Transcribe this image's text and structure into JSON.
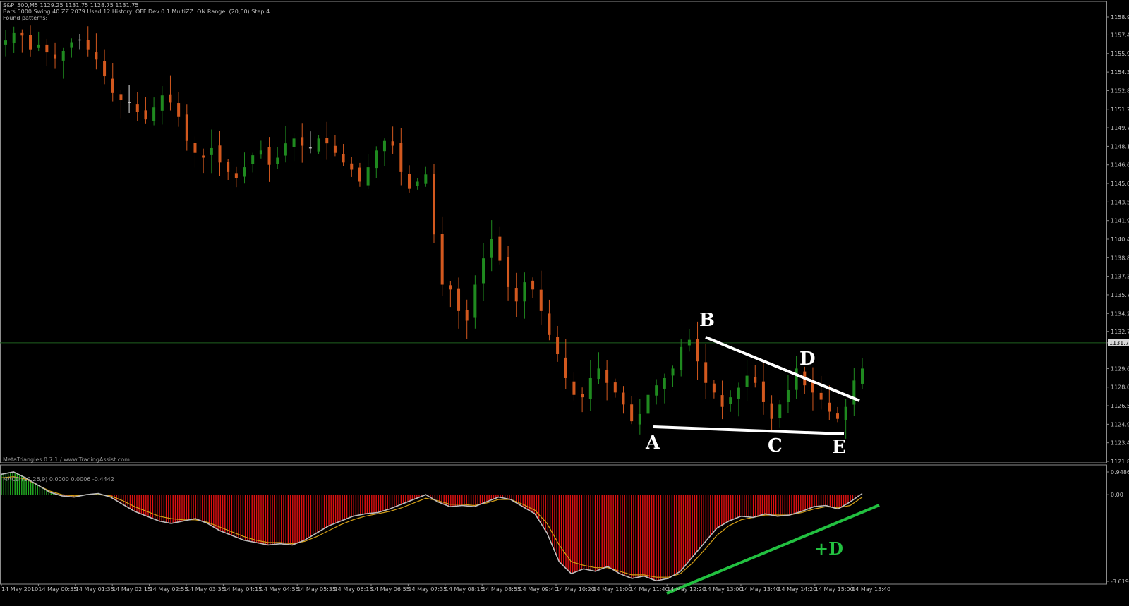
{
  "header": {
    "line1": "S&P_500,M5  1129.25 1131.75 1128.75 1131.75",
    "line2": "Bars:5000  Swing:40  ZZ:2079  Used:12  History: OFF Dev:0.1  MultiZZ: ON  Range: (20,60)  Step:4",
    "line3": "Found patterns:"
  },
  "watermark": "MetaTriangles 0.7.1 / www.TradingAssist.com",
  "macd_label": "MACD (12,26,9) 0.0000 0.0006 -0.4442",
  "price_axis": [
    "1158.95",
    "1157.45",
    "1155.90",
    "1154.35",
    "1152.80",
    "1151.25",
    "1149.70",
    "1148.15",
    "1146.60",
    "1145.05",
    "1143.50",
    "1141.95",
    "1140.40",
    "1138.85",
    "1137.30",
    "1135.75",
    "1134.20",
    "1132.70",
    "1131.75",
    "1129.60",
    "1128.05",
    "1126.50",
    "1124.95",
    "1123.40",
    "1121.85"
  ],
  "current_price": "1131.75",
  "macd_axis": [
    "0.9486",
    "0.00",
    "-3.6195"
  ],
  "time_axis": [
    "14 May 2010",
    "14 May 00:55",
    "14 May 01:35",
    "14 May 02:15",
    "14 May 02:55",
    "14 May 03:35",
    "14 May 04:15",
    "14 May 04:55",
    "14 May 05:35",
    "14 May 06:15",
    "14 May 06:55",
    "14 May 07:35",
    "14 May 08:15",
    "14 May 08:55",
    "14 May 09:40",
    "14 May 10:20",
    "14 May 11:00",
    "14 May 11:40",
    "14 May 12:20",
    "14 May 13:00",
    "14 May 13:40",
    "14 May 14:20",
    "14 May 15:00",
    "14 May 15:40"
  ],
  "pattern_labels": {
    "A": "A",
    "B": "B",
    "C": "C",
    "D": "D",
    "E": "E"
  },
  "divergence_label": "+D",
  "colors": {
    "bull": "#1f8a1f",
    "bear": "#d2581e",
    "neutral": "#e6e6e6",
    "hist_pos": "#22b022",
    "hist_neg": "#e01010",
    "signal": "#d4a017",
    "macd": "#bdbdbd",
    "pattern": "#ffffff",
    "divergence": "#22c040"
  },
  "chart_data": {
    "type": "candlestick",
    "symbol": "S&P_500",
    "timeframe": "M5",
    "ylim": [
      1121.85,
      1158.95
    ],
    "close_path": [
      1157.0,
      1157.6,
      1157.4,
      1156.2,
      1156.6,
      1156.0,
      1155.5,
      1156.1,
      1156.8,
      1157.0,
      1156.2,
      1155.4,
      1154.0,
      1152.6,
      1152.0,
      1151.8,
      1151.0,
      1150.4,
      1151.4,
      1152.4,
      1151.8,
      1150.6,
      1148.6,
      1147.6,
      1147.2,
      1148.0,
      1146.8,
      1146.0,
      1145.5,
      1146.4,
      1147.4,
      1147.8,
      1146.6,
      1147.2,
      1148.4,
      1148.8,
      1148.2,
      1148.0,
      1148.8,
      1148.4,
      1147.6,
      1146.8,
      1146.2,
      1145.2,
      1146.4,
      1147.8,
      1148.6,
      1148.2,
      1146.0,
      1144.6,
      1145.2,
      1145.8,
      1140.8,
      1136.6,
      1136.2,
      1134.4,
      1133.6,
      1136.6,
      1138.8,
      1140.4,
      1138.6,
      1136.4,
      1135.2,
      1136.8,
      1136.2,
      1134.4,
      1132.4,
      1130.8,
      1128.8,
      1127.4,
      1127.2,
      1128.8,
      1129.6,
      1128.4,
      1127.6,
      1126.6,
      1125.2,
      1125.8,
      1127.4,
      1128.2,
      1128.8,
      1129.6,
      1131.4,
      1132.0,
      1130.2,
      1128.4,
      1127.6,
      1126.4,
      1127.2,
      1128.0,
      1129.0,
      1128.4,
      1126.8,
      1125.4,
      1126.6,
      1127.8,
      1129.6,
      1128.2,
      1127.6,
      1127.0,
      1126.0,
      1125.4,
      1126.4,
      1128.6,
      1129.6
    ],
    "series": [
      {
        "name": "MACD",
        "values": [
          0.85,
          0.95,
          0.7,
          0.4,
          0.1,
          -0.05,
          -0.1,
          0.0,
          0.05,
          -0.1,
          -0.4,
          -0.7,
          -0.9,
          -1.1,
          -1.2,
          -1.1,
          -1.0,
          -1.2,
          -1.5,
          -1.7,
          -1.9,
          -2.0,
          -2.1,
          -2.05,
          -2.1,
          -1.9,
          -1.6,
          -1.3,
          -1.1,
          -0.9,
          -0.8,
          -0.75,
          -0.6,
          -0.4,
          -0.2,
          0.0,
          -0.3,
          -0.5,
          -0.45,
          -0.5,
          -0.3,
          -0.1,
          -0.2,
          -0.5,
          -0.8,
          -1.6,
          -2.8,
          -3.3,
          -3.1,
          -3.2,
          -3.0,
          -3.3,
          -3.5,
          -3.4,
          -3.6,
          -3.5,
          -3.2,
          -2.6,
          -2.0,
          -1.4,
          -1.1,
          -0.9,
          -0.95,
          -0.8,
          -0.9,
          -0.85,
          -0.7,
          -0.5,
          -0.45,
          -0.6,
          -0.3,
          0.05
        ]
      },
      {
        "name": "Signal",
        "values": [
          0.7,
          0.75,
          0.65,
          0.4,
          0.15,
          0.0,
          -0.05,
          0.0,
          0.0,
          -0.05,
          -0.25,
          -0.5,
          -0.7,
          -0.9,
          -1.0,
          -1.05,
          -1.05,
          -1.15,
          -1.35,
          -1.55,
          -1.75,
          -1.9,
          -2.0,
          -2.0,
          -2.05,
          -1.95,
          -1.75,
          -1.5,
          -1.25,
          -1.05,
          -0.9,
          -0.8,
          -0.7,
          -0.55,
          -0.35,
          -0.15,
          -0.25,
          -0.4,
          -0.4,
          -0.45,
          -0.35,
          -0.2,
          -0.2,
          -0.4,
          -0.65,
          -1.2,
          -2.1,
          -2.8,
          -2.95,
          -3.05,
          -3.05,
          -3.2,
          -3.35,
          -3.35,
          -3.45,
          -3.45,
          -3.3,
          -2.85,
          -2.3,
          -1.7,
          -1.3,
          -1.05,
          -0.95,
          -0.85,
          -0.85,
          -0.85,
          -0.75,
          -0.6,
          -0.5,
          -0.55,
          -0.45,
          -0.1
        ]
      }
    ],
    "annotations": [
      "A",
      "B",
      "C",
      "D",
      "E",
      "+D"
    ]
  }
}
